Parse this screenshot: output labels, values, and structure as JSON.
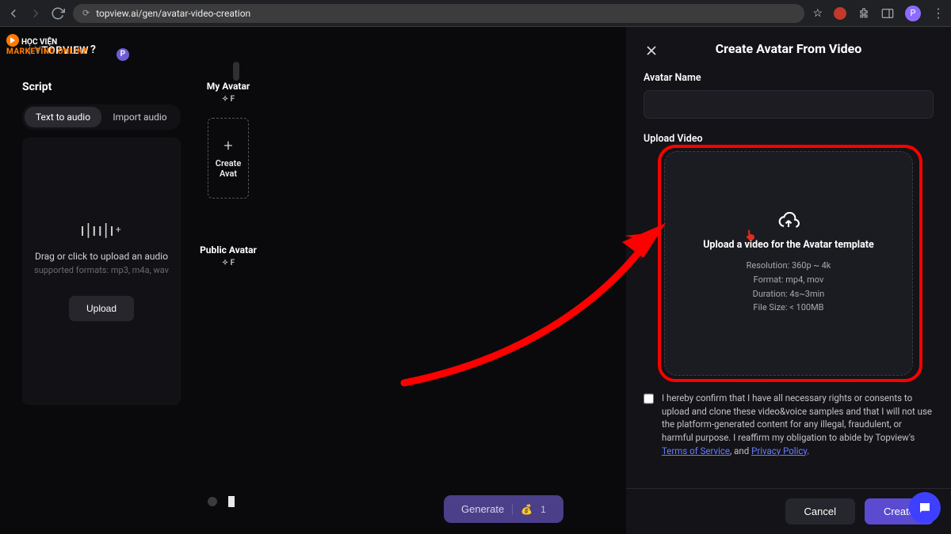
{
  "browser": {
    "url": "topview.ai/gen/avatar-video-creation",
    "profile_initial": "P"
  },
  "watermark": {
    "line1": "HỌC VIỆN",
    "line2": "MARKETING ONLINE",
    "brand": "TOPVIEW",
    "question": "?"
  },
  "script_panel": {
    "title": "Script",
    "tab_text_to_audio": "Text to audio",
    "tab_import_audio": "Import audio",
    "drop_label": "Drag or click to upload an audio",
    "drop_supported": "supported formats: mp3, m4a, wav",
    "upload_btn": "Upload"
  },
  "avatar_col": {
    "my_avatar": "My Avatar",
    "create": "Create",
    "avat": "Avat",
    "public_avatar": "Public Avatar"
  },
  "bottom": {
    "generate": "Generate",
    "credits": "1"
  },
  "panel": {
    "title": "Create Avatar From Video",
    "avatar_name_label": "Avatar Name",
    "avatar_name_value": "",
    "upload_video_label": "Upload Video",
    "upload_box_title": "Upload a video for the Avatar template",
    "spec_resolution": "Resolution: 360p ~ 4k",
    "spec_format": "Format: mp4, mov",
    "spec_duration": "Duration: 4s~3min",
    "spec_filesize": "File Size: < 100MB",
    "consent_text_1": "I hereby confirm that I have all necessary rights or consents to upload and clone these video&voice samples and that I will not use the platform-generated content for any illegal, fraudulent, or harmful purpose. I reaffirm my obligation to abide by Topview's ",
    "tos": "Terms of Service",
    "and": ", and ",
    "privacy": "Privacy Policy",
    "period": ".",
    "cancel": "Cancel",
    "create": "Create"
  }
}
